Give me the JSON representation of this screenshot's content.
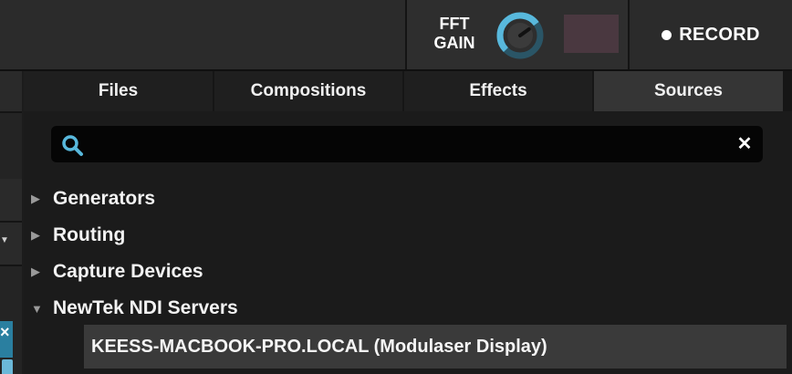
{
  "header": {
    "fft_gain_label_line1": "FFT",
    "fft_gain_label_line2": "GAIN",
    "gain_level": 0.7,
    "swatch_color": "#4a3840",
    "record_label": "RECORD"
  },
  "tabs": [
    {
      "label": "Files",
      "active": false
    },
    {
      "label": "Compositions",
      "active": false
    },
    {
      "label": "Effects",
      "active": false
    },
    {
      "label": "Sources",
      "active": true
    }
  ],
  "search": {
    "value": "",
    "placeholder": ""
  },
  "tree": [
    {
      "label": "Generators",
      "expanded": false
    },
    {
      "label": "Routing",
      "expanded": false
    },
    {
      "label": "Capture Devices",
      "expanded": false
    },
    {
      "label": "NewTek NDI Servers",
      "expanded": true,
      "children": [
        "KEESS-MACBOOK-PRO.LOCAL (Modulaser Display)"
      ]
    }
  ],
  "colors": {
    "accent_blue": "#58b8dc",
    "panel_bg": "#1b1b1b",
    "selected_row": "#3a3a3a"
  }
}
